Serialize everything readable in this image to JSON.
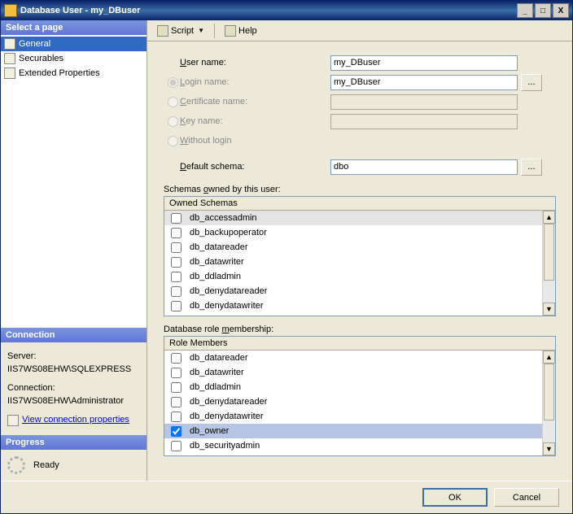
{
  "window": {
    "title": "Database User - my_DBuser"
  },
  "titlebar_buttons": {
    "minimize": "_",
    "maximize": "□",
    "close": "X"
  },
  "left": {
    "select_page": "Select a page",
    "pages": [
      {
        "label": "General",
        "selected": true
      },
      {
        "label": "Securables",
        "selected": false
      },
      {
        "label": "Extended Properties",
        "selected": false
      }
    ],
    "connection_header": "Connection",
    "server_label": "Server:",
    "server_value": "IIS7WS08EHW\\SQLEXPRESS",
    "connection_label": "Connection:",
    "connection_value": "IIS7WS08EHW\\Administrator",
    "view_connection_link": "View connection properties",
    "progress_header": "Progress",
    "progress_status": "Ready"
  },
  "toolbar": {
    "script": "Script",
    "help": "Help"
  },
  "form": {
    "user_name_label": "User name:",
    "user_name_value": "my_DBuser",
    "login_name_label": "Login name:",
    "login_name_value": "my_DBuser",
    "certificate_label": "Certificate name:",
    "key_label": "Key name:",
    "without_login_label": "Without login",
    "default_schema_label": "Default schema:",
    "default_schema_value": "dbo",
    "browse": "...",
    "schemas_label": "Schemas owned by this user:",
    "schemas_header": "Owned Schemas",
    "schemas": [
      {
        "name": "db_accessadmin",
        "checked": false
      },
      {
        "name": "db_backupoperator",
        "checked": false
      },
      {
        "name": "db_datareader",
        "checked": false
      },
      {
        "name": "db_datawriter",
        "checked": false
      },
      {
        "name": "db_ddladmin",
        "checked": false
      },
      {
        "name": "db_denydatareader",
        "checked": false
      },
      {
        "name": "db_denydatawriter",
        "checked": false
      }
    ],
    "roles_label": "Database role membership:",
    "roles_header": "Role Members",
    "roles": [
      {
        "name": "db_datareader",
        "checked": false
      },
      {
        "name": "db_datawriter",
        "checked": false
      },
      {
        "name": "db_ddladmin",
        "checked": false
      },
      {
        "name": "db_denydatareader",
        "checked": false
      },
      {
        "name": "db_denydatawriter",
        "checked": false
      },
      {
        "name": "db_owner",
        "checked": true
      },
      {
        "name": "db_securityadmin",
        "checked": false
      }
    ]
  },
  "buttons": {
    "ok": "OK",
    "cancel": "Cancel"
  }
}
